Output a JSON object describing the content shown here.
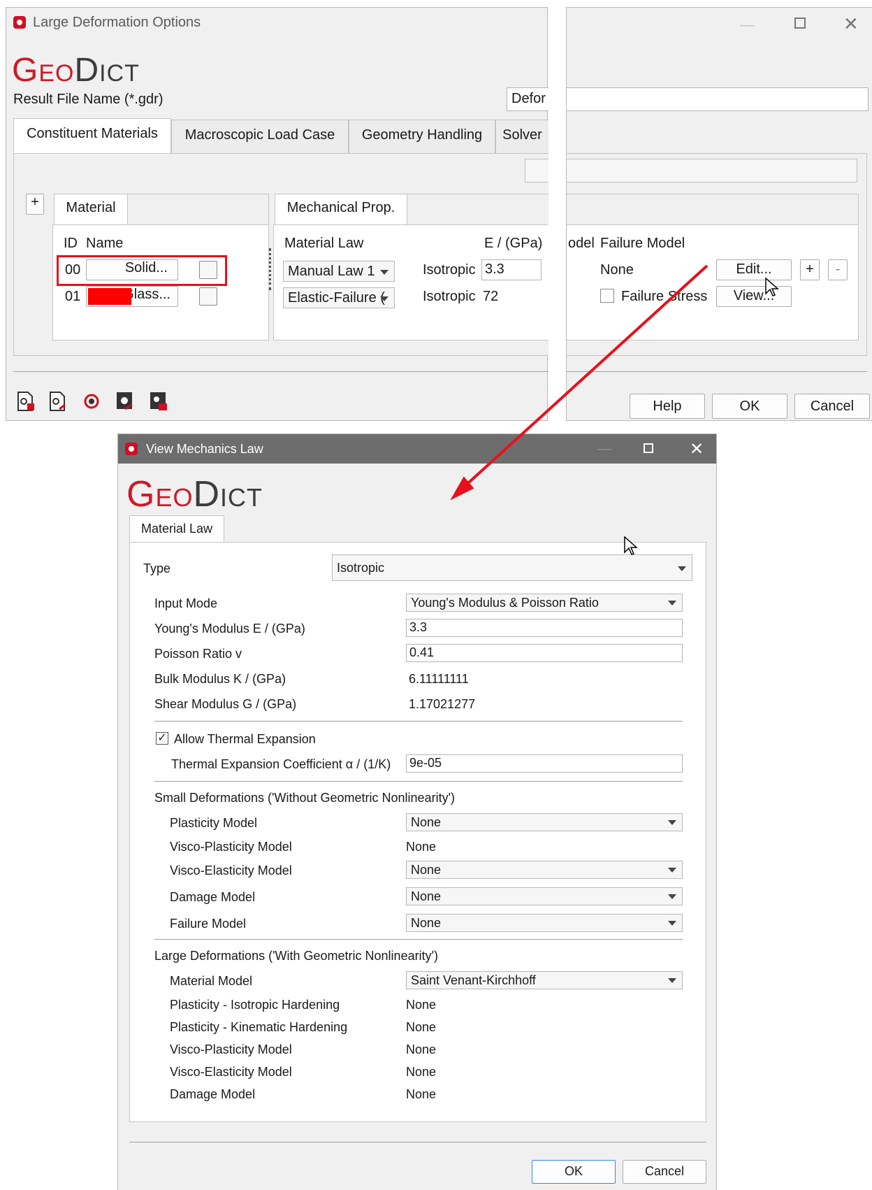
{
  "top_window": {
    "title": "Large Deformation Options",
    "logo": {
      "geo": "Geo",
      "dict": "Dict"
    },
    "result_file_label": "Result File Name (*.gdr)",
    "result_file_value": "Defor",
    "tabs": [
      "Constituent Materials",
      "Macroscopic Load Case",
      "Geometry Handling",
      "Solver"
    ],
    "material_panel": {
      "tab": "Material",
      "header_id": "ID",
      "header_name": "Name",
      "rows": [
        {
          "id": "00",
          "name": "Solid...",
          "color": "#ffffff"
        },
        {
          "id": "01",
          "name": "Glass...",
          "color": "#ff0000"
        }
      ]
    },
    "mech_panel": {
      "tab": "Mechanical Prop.",
      "col_law": "Material Law",
      "col_e": "E / (GPa)",
      "col_model": "odel",
      "col_failure": "Failure Model",
      "rows": [
        {
          "law": "Manual Law 1",
          "type": "Isotropic",
          "e": "3.3",
          "failure": "None",
          "button": "Edit..."
        },
        {
          "law": "Elastic-Failure (",
          "type": "Isotropic",
          "e": "72",
          "failure_check": "Failure Stress",
          "button": "View..."
        }
      ],
      "plus": "+",
      "minus": "-"
    },
    "add_material": "+",
    "buttons": {
      "help": "Help",
      "ok": "OK",
      "cancel": "Cancel"
    },
    "toolbar_icons": [
      "load-settings-icon",
      "save-settings-icon",
      "reset-settings-icon",
      "run-macro-icon",
      "lock-settings-icon"
    ]
  },
  "bottom_window": {
    "title": "View Mechanics Law",
    "logo": {
      "geo": "Geo",
      "dict": "Dict"
    },
    "tab": "Material Law",
    "type_label": "Type",
    "type_value": "Isotropic",
    "input_mode_label": "Input Mode",
    "input_mode_value": "Young's Modulus & Poisson Ratio",
    "youngs_label": "Young's Modulus E / (GPa)",
    "youngs_value": "3.3",
    "poisson_label": "Poisson Ratio v",
    "poisson_value": "0.41",
    "bulk_label": "Bulk Modulus K / (GPa)",
    "bulk_value": "6.11111111",
    "shear_label": "Shear Modulus G / (GPa)",
    "shear_value": "1.17021277",
    "thermal_check_label": "Allow Thermal Expansion",
    "thermal_checked": true,
    "thermal_coef_label": "Thermal Expansion Coefficient α / (1/K)",
    "thermal_coef_value": "9e-05",
    "small_def_title": "Small Deformations ('Without Geometric Nonlinearity')",
    "small_def": [
      {
        "label": "Plasticity Model",
        "value": "None",
        "combo": true
      },
      {
        "label": "Visco-Plasticity Model",
        "value": "None",
        "combo": false
      },
      {
        "label": "Visco-Elasticity Model",
        "value": "None",
        "combo": true
      },
      {
        "label": "Damage Model",
        "value": "None",
        "combo": true
      },
      {
        "label": "Failure Model",
        "value": "None",
        "combo": true
      }
    ],
    "large_def_title": "Large Deformations ('With Geometric Nonlinearity')",
    "large_def": [
      {
        "label": "Material Model",
        "value": "Saint Venant-Kirchhoff",
        "combo": true
      },
      {
        "label": "Plasticity - Isotropic Hardening",
        "value": "None",
        "combo": false
      },
      {
        "label": "Plasticity - Kinematic Hardening",
        "value": "None",
        "combo": false
      },
      {
        "label": "Visco-Plasticity Model",
        "value": "None",
        "combo": false
      },
      {
        "label": "Visco-Elasticity Model",
        "value": "None",
        "combo": false
      },
      {
        "label": "Damage Model",
        "value": "None",
        "combo": false
      }
    ],
    "buttons": {
      "ok": "OK",
      "cancel": "Cancel"
    }
  },
  "colors": {
    "highlight": "#e8101c",
    "brand": "#d01828",
    "arrow": "#e8101c"
  }
}
